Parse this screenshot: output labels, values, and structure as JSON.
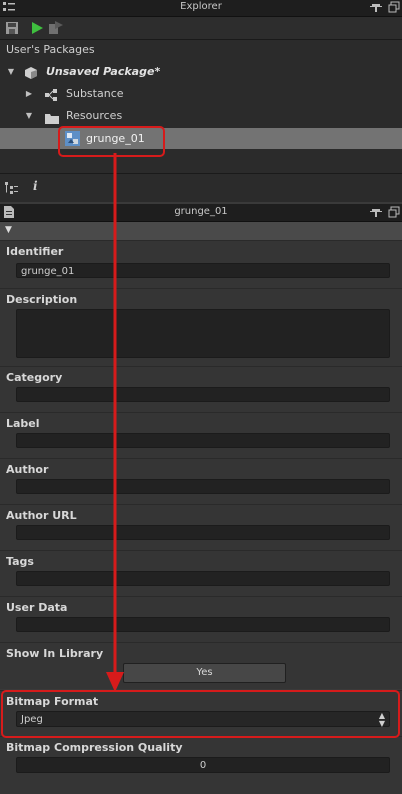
{
  "explorer": {
    "title": "Explorer",
    "section_title": "User's Packages",
    "tree": [
      {
        "label": "Unsaved Package*",
        "icon": "package-icon"
      },
      {
        "label": "Substance",
        "icon": "graph-nodes-icon"
      },
      {
        "label": "Resources",
        "icon": "folder-icon"
      },
      {
        "label": "grunge_01",
        "icon": "bitmap-resource-icon"
      }
    ]
  },
  "properties": {
    "title": "grunge_01",
    "fields": {
      "identifier": {
        "label": "Identifier",
        "value": "grunge_01"
      },
      "description": {
        "label": "Description",
        "value": ""
      },
      "category": {
        "label": "Category",
        "value": ""
      },
      "label": {
        "label": "Label",
        "value": ""
      },
      "author": {
        "label": "Author",
        "value": ""
      },
      "author_url": {
        "label": "Author URL",
        "value": ""
      },
      "tags": {
        "label": "Tags",
        "value": ""
      },
      "user_data": {
        "label": "User Data",
        "value": ""
      },
      "show_in_library": {
        "label": "Show In Library",
        "value": "Yes"
      },
      "bitmap_format": {
        "label": "Bitmap Format",
        "value": "Jpeg"
      },
      "bitmap_compression_quality": {
        "label": "Bitmap Compression Quality",
        "value": "0"
      }
    }
  },
  "colors": {
    "highlight": "#d61b1b",
    "selected_row": "#737373"
  }
}
